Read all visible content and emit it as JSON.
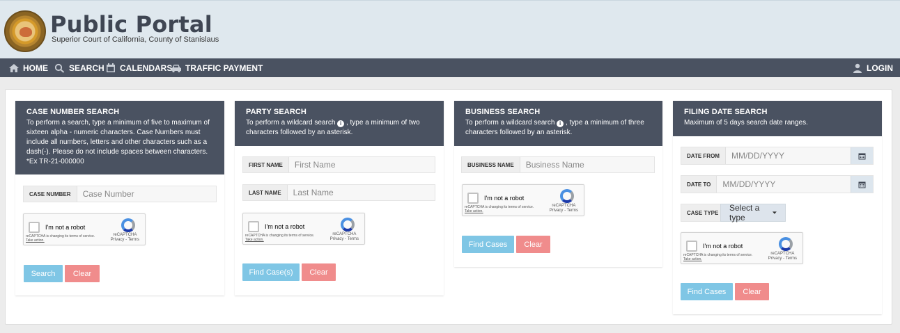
{
  "header": {
    "title": "Public Portal",
    "subtitle": "Superior Court of California, County of Stanislaus",
    "seal_icon": "court-seal"
  },
  "nav": {
    "home": "HOME",
    "search": "SEARCH",
    "calendars": "CALENDARS",
    "traffic_payment": "TRAFFIC PAYMENT",
    "login": "LOGIN"
  },
  "case_number_search": {
    "title": "CASE NUMBER SEARCH",
    "description": "To perform a search, type a minimum of five to maximum of sixteen alpha - numeric characters. Case Numbers must include all numbers, letters and other characters such as a dash(-). Please do not include spaces between characters.",
    "example": "*Ex TR-21-000000",
    "field_label": "CASE NUMBER",
    "placeholder": "Case Number",
    "search_button": "Search",
    "clear_button": "Clear"
  },
  "party_search": {
    "title": "PARTY SEARCH",
    "desc_before": "To perform a wildcard search",
    "desc_after": ", type a minimum of two characters followed by an asterisk.",
    "first_name_label": "FIRST NAME",
    "first_name_placeholder": "First Name",
    "last_name_label": "LAST NAME",
    "last_name_placeholder": "Last Name",
    "find_button": "Find Case(s)",
    "clear_button": "Clear"
  },
  "business_search": {
    "title": "BUSINESS SEARCH",
    "desc_before": "To perform a wildcard search",
    "desc_after": ", type a minimum of three characters followed by an asterisk.",
    "field_label": "BUSINESS NAME",
    "placeholder": "Business Name",
    "find_button": "Find Cases",
    "clear_button": "Clear"
  },
  "filing_date_search": {
    "title": "FILING DATE SEARCH",
    "description": "Maximum of 5 days search date ranges.",
    "date_from_label": "DATE FROM",
    "date_from_placeholder": "MM/DD/YYYY",
    "date_to_label": "DATE TO",
    "date_to_placeholder": "MM/DD/YYYY",
    "case_type_label": "CASE TYPE",
    "case_type_selected": "Select a type",
    "find_button": "Find Cases",
    "clear_button": "Clear"
  },
  "captcha": {
    "label": "I'm not a robot",
    "brand": "reCAPTCHA",
    "privacy_terms": "Privacy - Terms",
    "notice": "reCAPTCHA is changing its terms of service.",
    "take_action": "Take action."
  },
  "colors": {
    "nav_bg": "#4a5261",
    "header_bg": "#dfe8ee",
    "primary_button": "#7fc6e5",
    "clear_button": "#f08c8c"
  }
}
